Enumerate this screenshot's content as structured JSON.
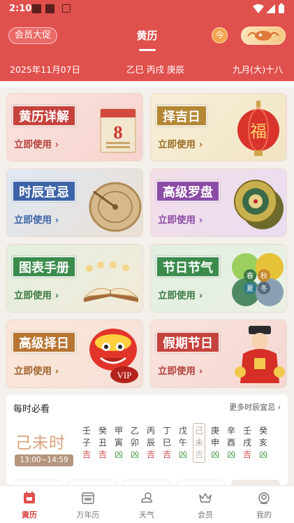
{
  "status_bar": {
    "time": "2:10"
  },
  "header": {
    "promo": "会员大促",
    "title": "黄历",
    "today": "今"
  },
  "date_band": {
    "gregorian": "2025年11月07日",
    "ganzhi": "乙巳 丙戌 庚辰",
    "lunar": "九月(大)十八"
  },
  "cards": [
    {
      "title": "黄历详解",
      "action": "立即使用",
      "icon": "calendar-8-icon",
      "accent": "#c6423c"
    },
    {
      "title": "择吉日",
      "action": "立即使用",
      "icon": "lantern-icon",
      "art_text": "福",
      "accent": "#b48734"
    },
    {
      "title": "时辰宜忌",
      "action": "立即使用",
      "icon": "sundial-icon",
      "accent": "#3d64a8"
    },
    {
      "title": "高级罗盘",
      "action": "立即使用",
      "icon": "compass-icon",
      "accent": "#8b4ca5"
    },
    {
      "title": "图表手册",
      "action": "立即使用",
      "icon": "book-icon",
      "accent": "#3b8c4c"
    },
    {
      "title": "节日节气",
      "action": "立即使用",
      "icon": "seasons-icon",
      "art_text": [
        "春",
        "秋",
        "夏",
        "冬"
      ],
      "accent": "#3b8c4c"
    },
    {
      "title": "高级择日",
      "action": "立即使用",
      "icon": "lion-dance-icon",
      "art_text": "VIP",
      "accent": "#b87532"
    },
    {
      "title": "假期节日",
      "action": "立即使用",
      "icon": "fortune-god-icon",
      "accent": "#c6423c"
    }
  ],
  "hourly": {
    "title": "每时必看",
    "more": "更多时辰宜忌",
    "current_hour": "己未时",
    "current_range": "13:00~14:59",
    "hours": [
      {
        "stem": "壬",
        "branch": "子",
        "luck": "吉"
      },
      {
        "stem": "癸",
        "branch": "丑",
        "luck": "吉"
      },
      {
        "stem": "甲",
        "branch": "寅",
        "luck": "凶"
      },
      {
        "stem": "乙",
        "branch": "卯",
        "luck": "凶"
      },
      {
        "stem": "丙",
        "branch": "辰",
        "luck": "吉"
      },
      {
        "stem": "丁",
        "branch": "巳",
        "luck": "吉"
      },
      {
        "stem": "戊",
        "branch": "午",
        "luck": "凶"
      },
      {
        "stem": "己",
        "branch": "未",
        "luck": "吉",
        "active": true
      },
      {
        "stem": "庚",
        "branch": "申",
        "luck": "凶"
      },
      {
        "stem": "辛",
        "branch": "酉",
        "luck": "凶"
      },
      {
        "stem": "壬",
        "branch": "戌",
        "luck": "吉"
      },
      {
        "stem": "癸",
        "branch": "亥",
        "luck": "凶"
      }
    ]
  },
  "tabs": [
    {
      "label": "黄历",
      "icon": "almanac-icon",
      "active": true
    },
    {
      "label": "万年历",
      "icon": "calendar-365-icon"
    },
    {
      "label": "天气",
      "icon": "weather-icon"
    },
    {
      "label": "会员",
      "icon": "crown-icon"
    },
    {
      "label": "我的",
      "icon": "profile-icon"
    }
  ],
  "colors": {
    "brand_red": "#e0504d",
    "lucky": "#d44b45",
    "unlucky": "#3f9a46"
  }
}
